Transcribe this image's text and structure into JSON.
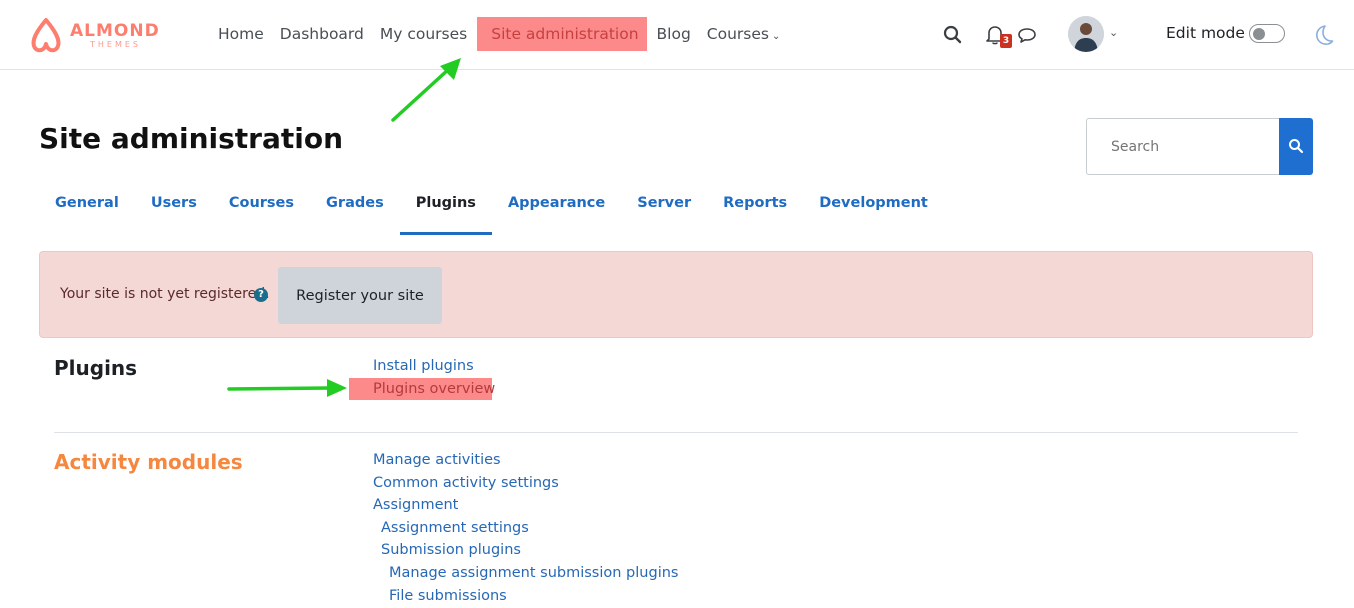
{
  "brand": {
    "name": "ALMOND",
    "subtitle": "THEMES",
    "color": "#fd7e6e"
  },
  "nav": {
    "items": [
      {
        "label": "Home"
      },
      {
        "label": "Dashboard"
      },
      {
        "label": "My courses"
      },
      {
        "label": "Site administration",
        "highlighted": true
      },
      {
        "label": "Blog"
      },
      {
        "label": "Courses"
      }
    ],
    "notification_count": "3",
    "edit_mode_label": "Edit mode",
    "edit_mode_on": false
  },
  "page": {
    "title": "Site administration",
    "search_placeholder": "Search"
  },
  "tabs": [
    {
      "label": "General"
    },
    {
      "label": "Users"
    },
    {
      "label": "Courses"
    },
    {
      "label": "Grades"
    },
    {
      "label": "Plugins",
      "active": true
    },
    {
      "label": "Appearance"
    },
    {
      "label": "Server"
    },
    {
      "label": "Reports"
    },
    {
      "label": "Development"
    }
  ],
  "alert": {
    "text": "Your site is not yet registered.",
    "button": "Register your site"
  },
  "sections": [
    {
      "title": "Plugins",
      "links": [
        {
          "label": "Install plugins"
        },
        {
          "label": "Plugins overview",
          "highlighted": true
        }
      ]
    },
    {
      "title": "Activity modules",
      "links": [
        {
          "label": "Manage activities"
        },
        {
          "label": "Common activity settings"
        },
        {
          "label": "Assignment"
        },
        {
          "label": "Assignment settings",
          "indent": 1
        },
        {
          "label": "Submission plugins",
          "indent": 1
        },
        {
          "label": "Manage assignment submission plugins",
          "indent": 2
        },
        {
          "label": "File submissions",
          "indent": 2
        }
      ]
    }
  ],
  "colors": {
    "link": "#2668b5",
    "highlight": "#fd8a8a",
    "arrow": "#22cc22",
    "accent_orange": "#f5873e",
    "primary": "#1f6fd1"
  }
}
